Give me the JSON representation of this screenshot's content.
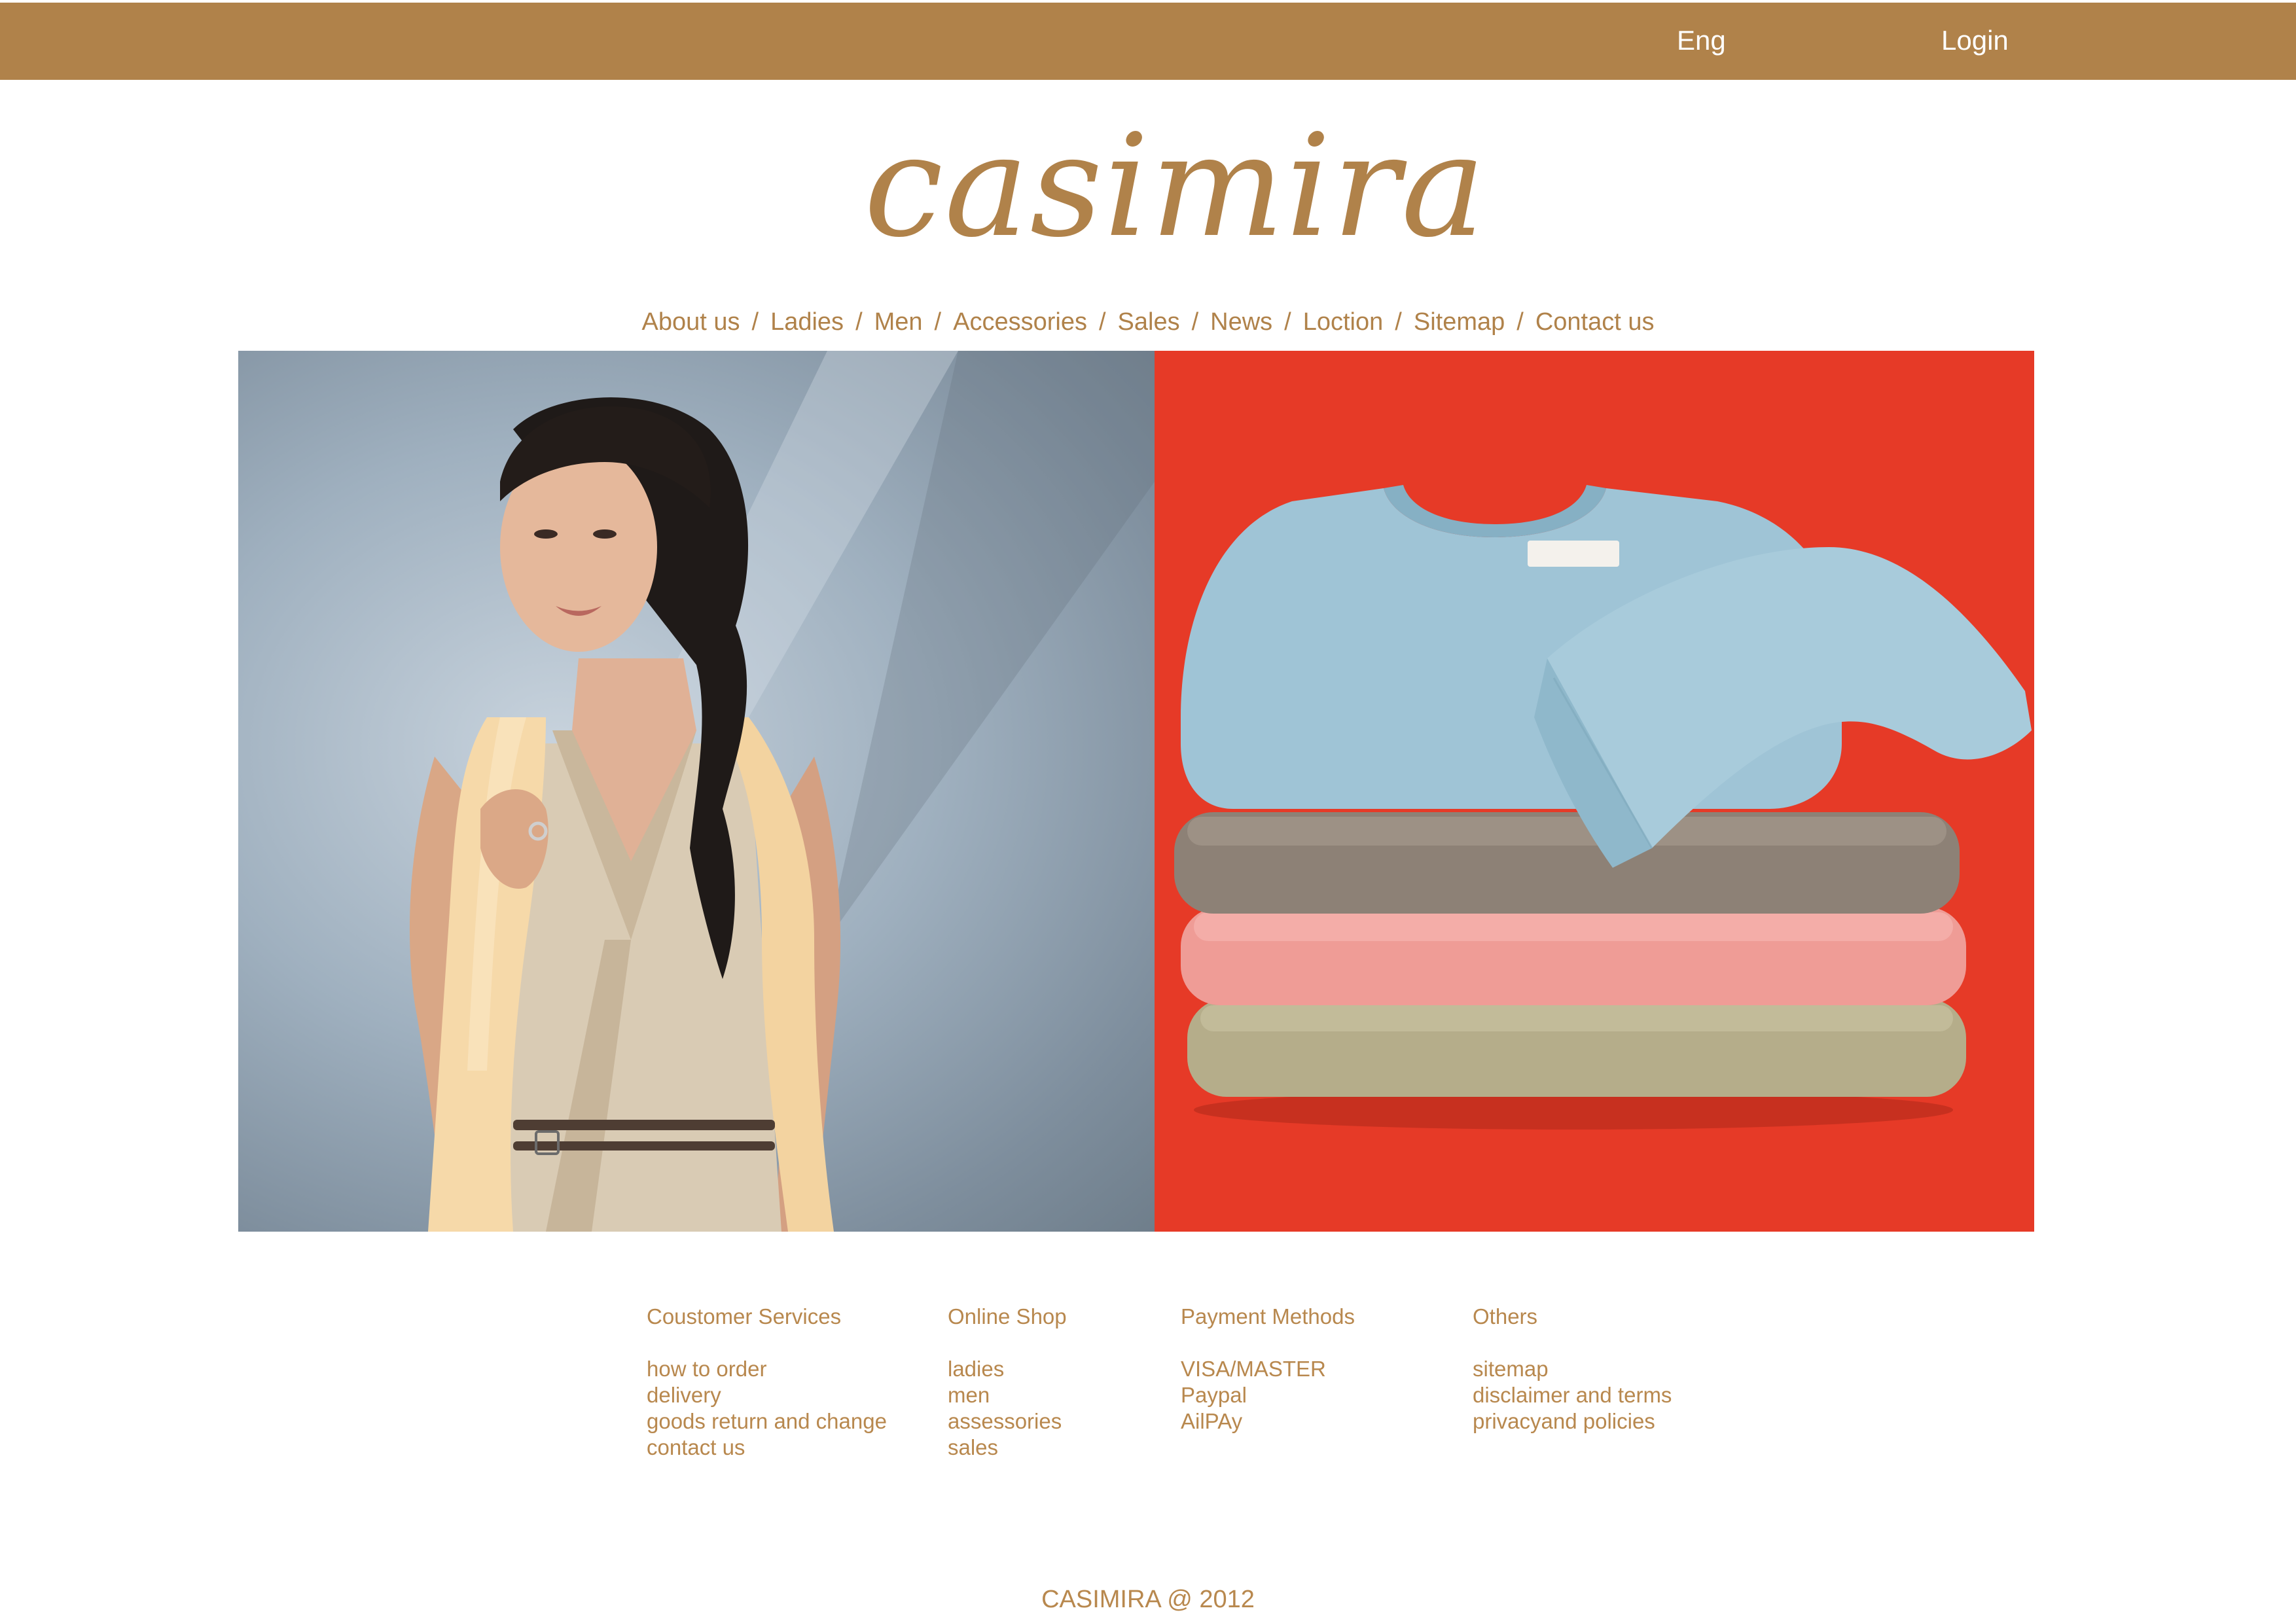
{
  "colors": {
    "brand": "#b0824a",
    "topbar_text": "#ffffff",
    "hero_right_background": "#e63a27"
  },
  "topbar": {
    "language": "Eng",
    "login": "Login"
  },
  "logo": {
    "text": "casimira"
  },
  "nav": {
    "items": [
      "About us",
      "Ladies",
      "Men",
      "Accessories",
      "Sales",
      "News",
      "Loction",
      "Sitemap",
      "Contact us"
    ],
    "separator": "/"
  },
  "footer": {
    "columns": [
      {
        "title": "Coustomer Services",
        "links": [
          "how to order",
          "delivery",
          "goods return and change",
          "contact us"
        ]
      },
      {
        "title": "Online Shop",
        "links": [
          "ladies",
          "men",
          "assessories",
          "sales"
        ]
      },
      {
        "title": "Payment Methods",
        "links": [
          "VISA/MASTER",
          "Paypal",
          "AilPAy"
        ]
      },
      {
        "title": "Others",
        "links": [
          "sitemap",
          "disclaimer and terms",
          "privacyand policies"
        ]
      }
    ],
    "copyright": "CASIMIRA @ 2012"
  }
}
